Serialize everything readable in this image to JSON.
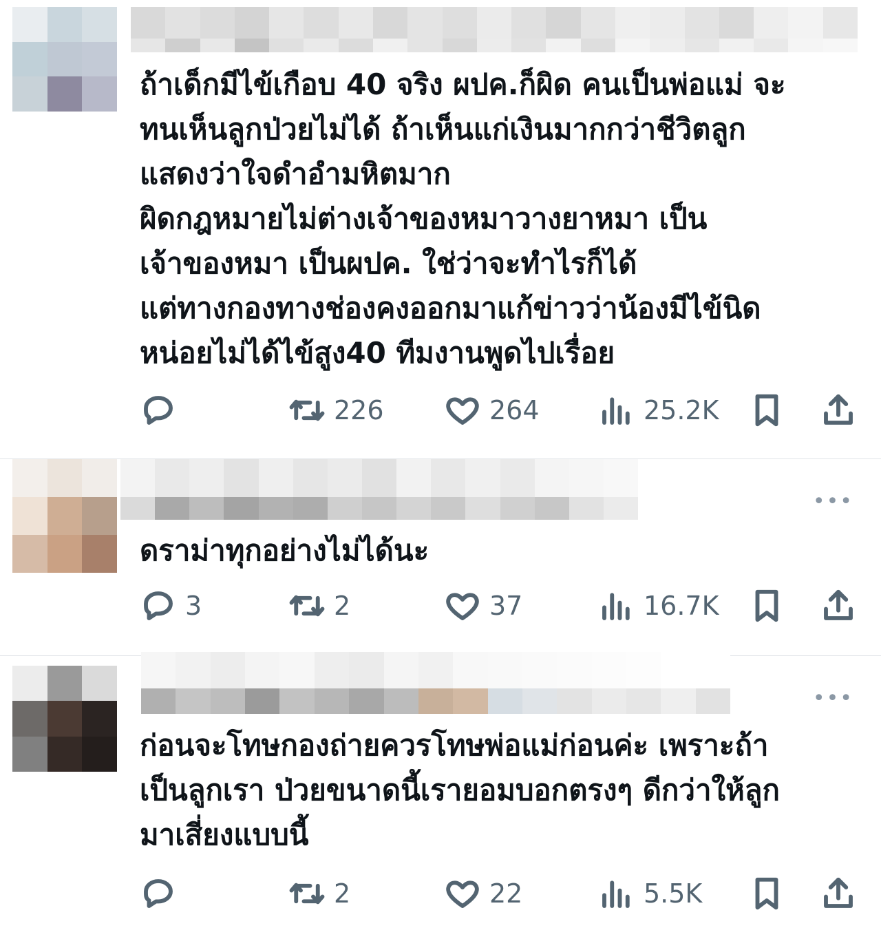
{
  "posts": [
    {
      "text": "ถ้าเด็กมีไข้เกือบ 40 จริง ผปค.ก็ผิด คนเป็นพ่อแม่ จะ\nทนเห็นลูกป่วยไม่ได้ ถ้าเห็นแก่เงินมากกว่าชีวิตลูก\nแสดงว่าใจดำอำมหิตมาก\nผิดกฎหมายไม่ต่างเจ้าของหมาวางยาหมา เป็น\nเจ้าของหมา เป็นผปค. ใช่ว่าจะทำไรก็ได้\nแต่ทางกองทางช่องคงออกมาแก้ข่าวว่าน้องมีไข้นิด\nหน่อยไม่ได้ไข้สูง40 ทีมงานพูดไปเรื่อย",
      "replies": "",
      "reposts": "226",
      "likes": "264",
      "views": "25.2K"
    },
    {
      "text": "ดราม่าทุกอย่างไม่ได้นะ",
      "replies": "3",
      "reposts": "2",
      "likes": "37",
      "views": "16.7K"
    },
    {
      "text": "ก่อนจะโทษกองถ่ายควรโทษพ่อแม่ก่อนค่ะ เพราะถ้า\nเป็นลูกเรา ป่วยขนาดนี้เรายอมบอกตรงๆ ดีกว่าให้ลูก\nมาเสี่ยงแบบนี้",
      "replies": "",
      "reposts": "2",
      "likes": "22",
      "views": "5.5K"
    }
  ],
  "icons": {
    "reply": "reply-icon",
    "repost": "repost-icon",
    "like": "heart-icon",
    "views": "views-icon",
    "bookmark": "bookmark-icon",
    "share": "share-icon",
    "more": "more-icon"
  },
  "colors": {
    "text": "#0f1419",
    "muted": "#536471",
    "divider": "#e1e4e8"
  }
}
